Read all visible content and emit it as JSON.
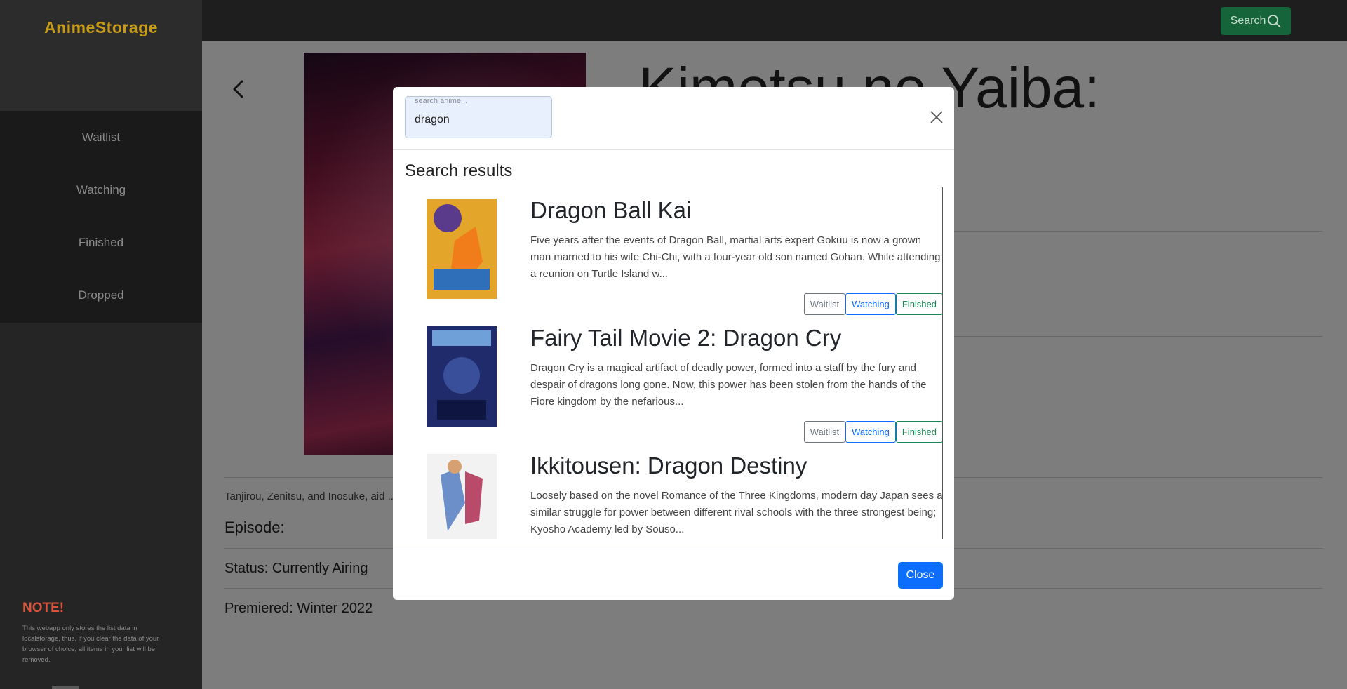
{
  "app": {
    "brand": "AnimeStorage"
  },
  "sidebar": {
    "items": [
      {
        "label": "Waitlist"
      },
      {
        "label": "Watching"
      },
      {
        "label": "Finished"
      },
      {
        "label": "Dropped"
      }
    ],
    "note": {
      "title": "NOTE!",
      "body": "This webapp only stores the list data in localstorage, thus, if you clear the data of your browser of choice, all items in your list will be removed."
    }
  },
  "header": {
    "search_label": "Search"
  },
  "detail": {
    "title": "Kimetsu no Yaiba: ...n",
    "synopsis": "Tanjirou, Zenitsu, and Inosuke, aid ... errorizing the town.",
    "episode": "Episode:",
    "status": "Status: Currently Airing",
    "premiered": "Premiered: Winter 2022"
  },
  "modal": {
    "search": {
      "placeholder": "search anime...",
      "value": "dragon"
    },
    "heading": "Search results",
    "close_label": "Close",
    "results": [
      {
        "title": "Dragon Ball Kai",
        "description": "Five years after the events of Dragon Ball, martial arts expert Gokuu is now a grown man married to his wife Chi-Chi, with a four-year old son named Gohan. While attending a reunion on Turtle Island w...",
        "buttons": {
          "waitlist": "Waitlist",
          "watching": "Watching",
          "finished": "Finished"
        }
      },
      {
        "title": "Fairy Tail Movie 2: Dragon Cry",
        "description": "Dragon Cry is a magical artifact of deadly power, formed into a staff by the fury and despair of dragons long gone. Now, this power has been stolen from the hands of the Fiore kingdom by the nefarious...",
        "buttons": {
          "waitlist": "Waitlist",
          "watching": "Watching",
          "finished": "Finished"
        }
      },
      {
        "title": "Ikkitousen: Dragon Destiny",
        "description": "Loosely based on the novel Romance of the Three Kingdoms, modern day Japan sees a similar struggle for power between different rival schools with the three strongest being; Kyosho Academy led by Souso..."
      }
    ]
  },
  "colors": {
    "brand": "#c79a17",
    "search_button": "#16643a",
    "primary": "#0d6efd",
    "success": "#198754",
    "secondary": "#6c757d",
    "note": "#d9543a"
  }
}
